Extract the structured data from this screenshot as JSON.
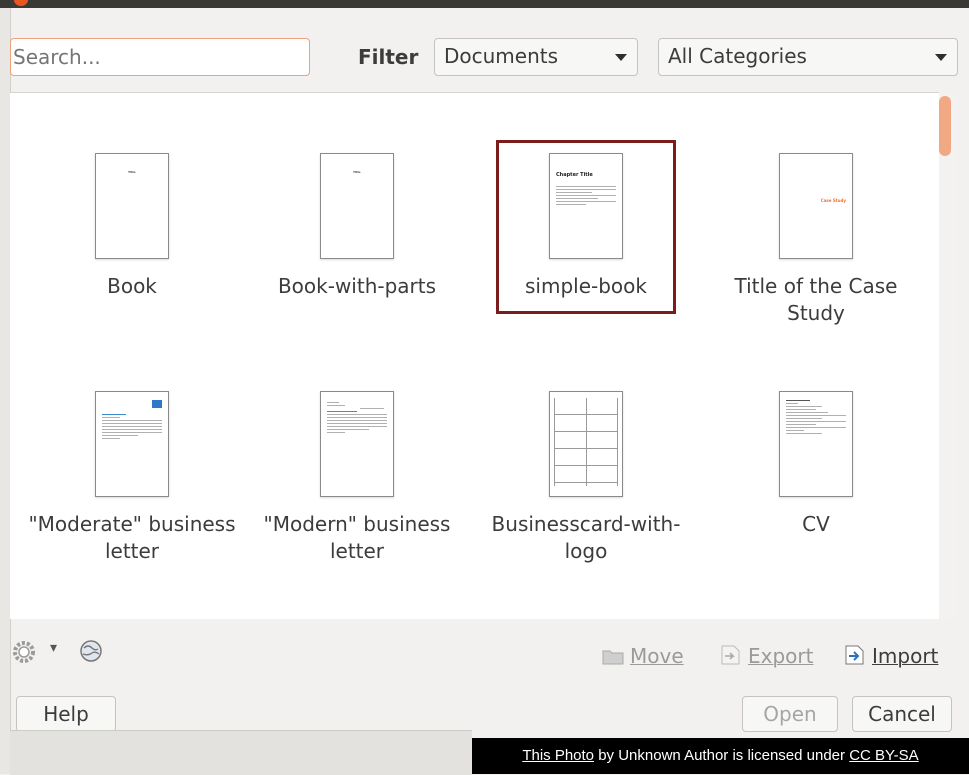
{
  "search": {
    "placeholder": "Search..."
  },
  "filter": {
    "label": "Filter",
    "type_selected": "Documents",
    "category_selected": "All Categories"
  },
  "templates": [
    {
      "name": "Book",
      "thumb_title": "Title"
    },
    {
      "name": "Book-with-parts",
      "thumb_title": "Title"
    },
    {
      "name": "simple-book",
      "thumb_title": "Chapter Title",
      "selected": true
    },
    {
      "name": "Title of the Case Study",
      "thumb_title": "Case Study"
    },
    {
      "name": "\"Moderate\" business letter"
    },
    {
      "name": "\"Modern\" business letter"
    },
    {
      "name": "Businesscard-with-logo"
    },
    {
      "name": "CV"
    }
  ],
  "actions": {
    "move": "Move",
    "export": "Export",
    "import": "Import"
  },
  "buttons": {
    "help": "Help",
    "open": "Open",
    "cancel": "Cancel"
  },
  "credit": {
    "photo_link": "This Photo",
    "middle": " by Unknown Author is licensed under ",
    "license_link": "CC BY-SA"
  },
  "colors": {
    "accent": "#e95420",
    "selection_border": "#7b1d1d"
  },
  "icons": [
    "settings-gear-icon",
    "dropdown-arrow-icon",
    "online-globe-icon",
    "move-folder-icon",
    "export-icon",
    "import-icon"
  ]
}
